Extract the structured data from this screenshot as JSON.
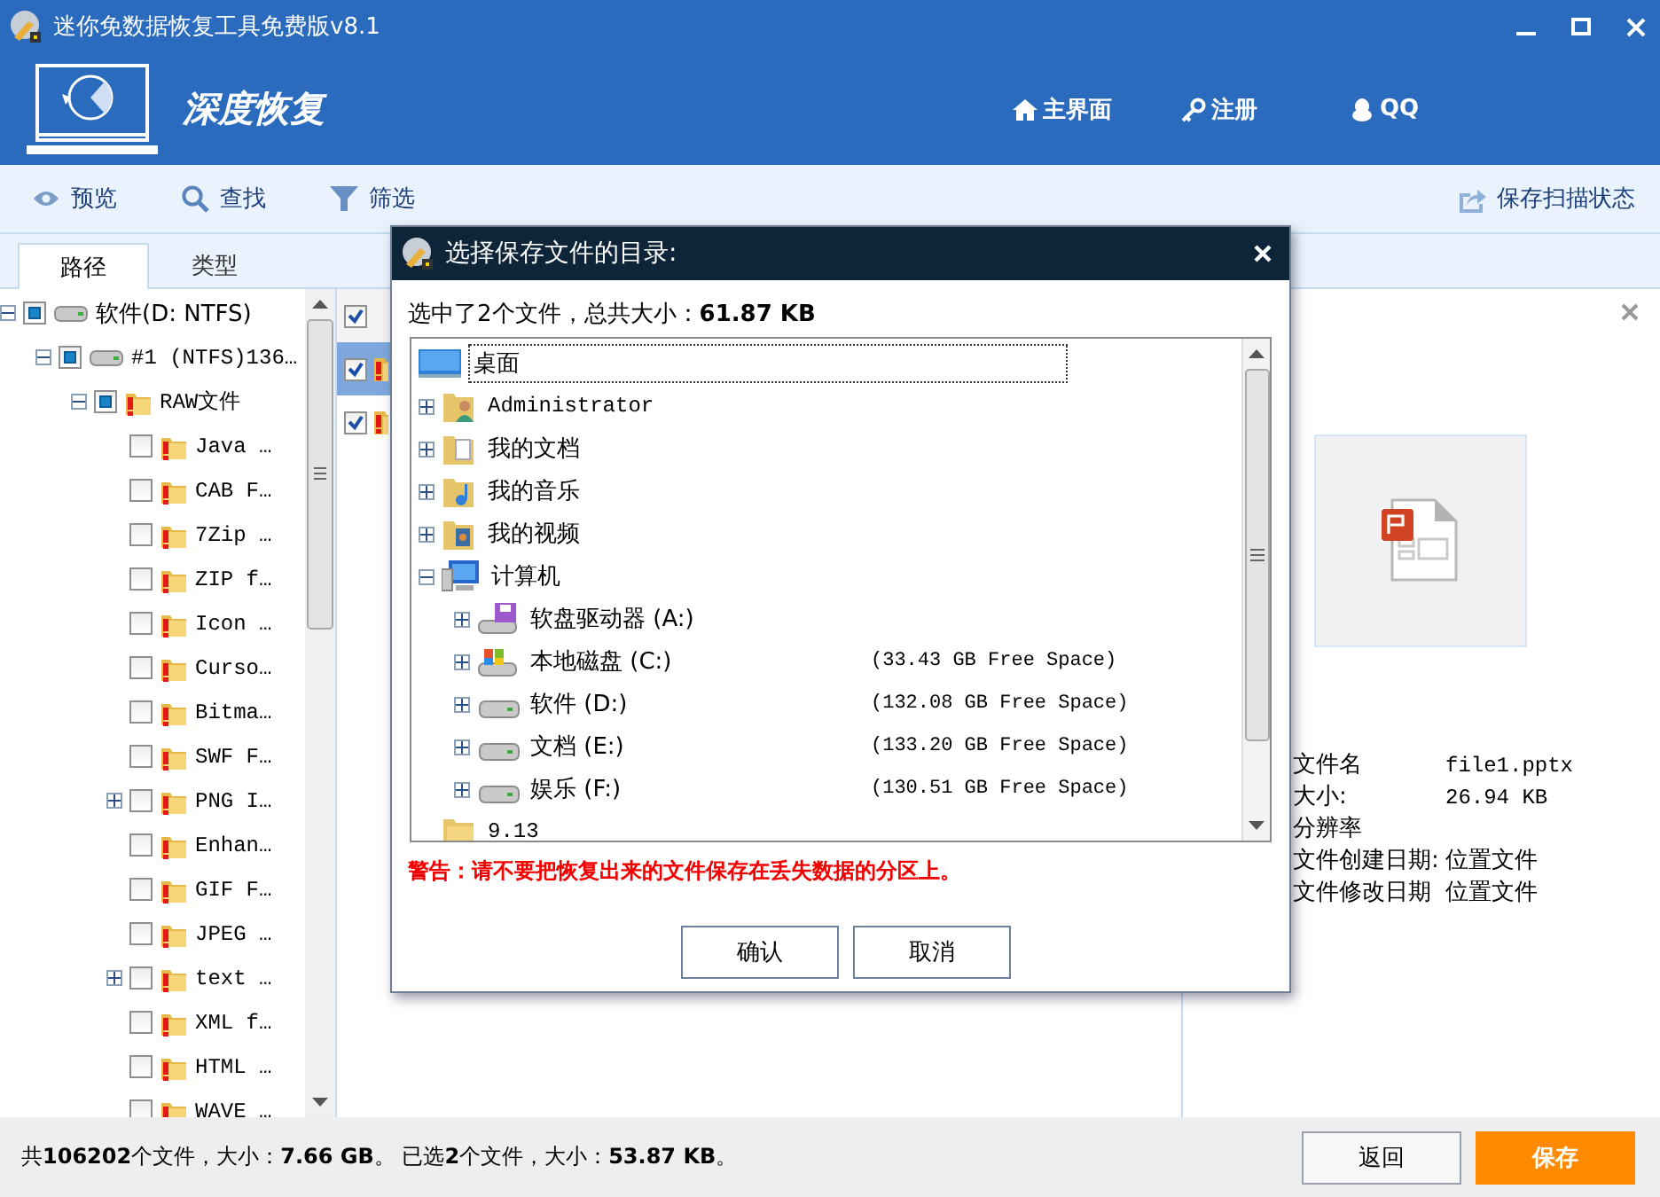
{
  "window": {
    "title": "迷你免数据恢复工具免费版v8.1"
  },
  "header": {
    "title": "深度恢复",
    "nav": [
      {
        "kind": "home",
        "label": "主界面"
      },
      {
        "kind": "key",
        "label": "注册"
      },
      {
        "kind": "qq",
        "label": "QQ"
      }
    ]
  },
  "toolbar": {
    "items": [
      {
        "kind": "eye",
        "label": "预览"
      },
      {
        "kind": "search",
        "label": "查找"
      },
      {
        "kind": "filter",
        "label": "筛选"
      }
    ],
    "save_state": "保存扫描状态"
  },
  "tabs": [
    {
      "label": "路径",
      "selected": true
    },
    {
      "label": "类型",
      "selected": false
    }
  ],
  "tree": [
    {
      "label": "软件(D: NTFS)",
      "kind": "drive",
      "checked": false,
      "indeterminate": true,
      "expanded": true,
      "children": [
        {
          "label": "#1 (NTFS)136…",
          "kind": "drive",
          "checked": false,
          "indeterminate": true,
          "expanded": true,
          "children": [
            {
              "label": "RAW文件",
              "kind": "folder",
              "checked": false,
              "indeterminate": true,
              "expanded": true,
              "children": [
                {
                  "label": "Java …",
                  "kind": "folder",
                  "checked": false
                },
                {
                  "label": "CAB F…",
                  "kind": "folder",
                  "checked": false
                },
                {
                  "label": "7Zip …",
                  "kind": "folder",
                  "checked": false
                },
                {
                  "label": "ZIP f…",
                  "kind": "folder",
                  "checked": false
                },
                {
                  "label": "Icon …",
                  "kind": "folder",
                  "checked": false
                },
                {
                  "label": "Curso…",
                  "kind": "folder",
                  "checked": false
                },
                {
                  "label": "Bitma…",
                  "kind": "folder",
                  "checked": false
                },
                {
                  "label": "SWF F…",
                  "kind": "folder",
                  "checked": false
                },
                {
                  "label": "PNG I…",
                  "kind": "folder",
                  "checked": false,
                  "expanded": false
                },
                {
                  "label": "Enhan…",
                  "kind": "folder",
                  "checked": false
                },
                {
                  "label": "GIF F…",
                  "kind": "folder",
                  "checked": false
                },
                {
                  "label": "JPEG …",
                  "kind": "folder",
                  "checked": false
                },
                {
                  "label": "text …",
                  "kind": "folder",
                  "checked": false,
                  "expanded": false
                },
                {
                  "label": "XML f…",
                  "kind": "folder",
                  "checked": false
                },
                {
                  "label": "HTML …",
                  "kind": "folder",
                  "checked": false
                },
                {
                  "label": "WAVE …",
                  "kind": "folder",
                  "checked": false
                }
              ]
            }
          ]
        }
      ]
    }
  ],
  "file_list": {
    "rows": [
      {
        "checked": true,
        "kind": "header"
      },
      {
        "checked": true,
        "selected": true,
        "kind": "file"
      },
      {
        "checked": true,
        "selected": false,
        "kind": "file"
      }
    ]
  },
  "preview": {
    "properties": [
      {
        "label": "文件名",
        "value": "file1.pptx"
      },
      {
        "label": "大小:",
        "value": "26.94 KB"
      },
      {
        "label": "分辨率"
      },
      {
        "label": "文件创建日期:",
        "value": "位置文件"
      },
      {
        "label": "文件修改日期",
        "value": "位置文件"
      }
    ]
  },
  "dialog": {
    "title": "选择保存文件的目录:",
    "summary": "选中了2个文件，总共大小：**61.87 KB**",
    "tree": [
      {
        "label": "桌面",
        "kind": "desktop",
        "selected": true,
        "children": [
          {
            "label": "Administrator",
            "kind": "user",
            "selected": false,
            "expanded": false
          },
          {
            "label": "我的文档",
            "kind": "documents",
            "selected": false,
            "expanded": false
          },
          {
            "label": "我的音乐",
            "kind": "music",
            "selected": false,
            "expanded": false
          },
          {
            "label": "我的视频",
            "kind": "video",
            "selected": false,
            "expanded": false
          },
          {
            "label": "计算机",
            "kind": "computer",
            "selected": false,
            "expanded": true,
            "children": [
              {
                "label": "软盘驱动器 (A:)",
                "kind": "floppy",
                "selected": false,
                "expanded": false
              },
              {
                "label": "本地磁盘 (C:)",
                "kind": "system",
                "selected": false,
                "expanded": false,
                "free": "(33.43 GB Free Space)"
              },
              {
                "label": "软件 (D:)",
                "kind": "drive",
                "selected": false,
                "expanded": false,
                "free": "(132.08 GB Free Space)"
              },
              {
                "label": "文档 (E:)",
                "kind": "drive",
                "selected": false,
                "expanded": false,
                "free": "(133.20 GB Free Space)"
              },
              {
                "label": "娱乐 (F:)",
                "kind": "drive",
                "selected": false,
                "expanded": false,
                "free": "(130.51 GB Free Space)"
              }
            ]
          },
          {
            "label": "9.13",
            "kind": "folder",
            "selected": false
          }
        ]
      }
    ],
    "warning": "警告：请不要把恢复出来的文件保存在丢失数据的分区上。",
    "buttons": [
      "确认",
      "取消"
    ]
  },
  "status": "共**106202**个文件，大小：**7.66 GB**。 已选**2**个文件，大小：**53.87 KB**。",
  "bottom_buttons": [
    {
      "label": "返回",
      "kind": "secondary"
    },
    {
      "label": "保存",
      "kind": "primary"
    }
  ]
}
